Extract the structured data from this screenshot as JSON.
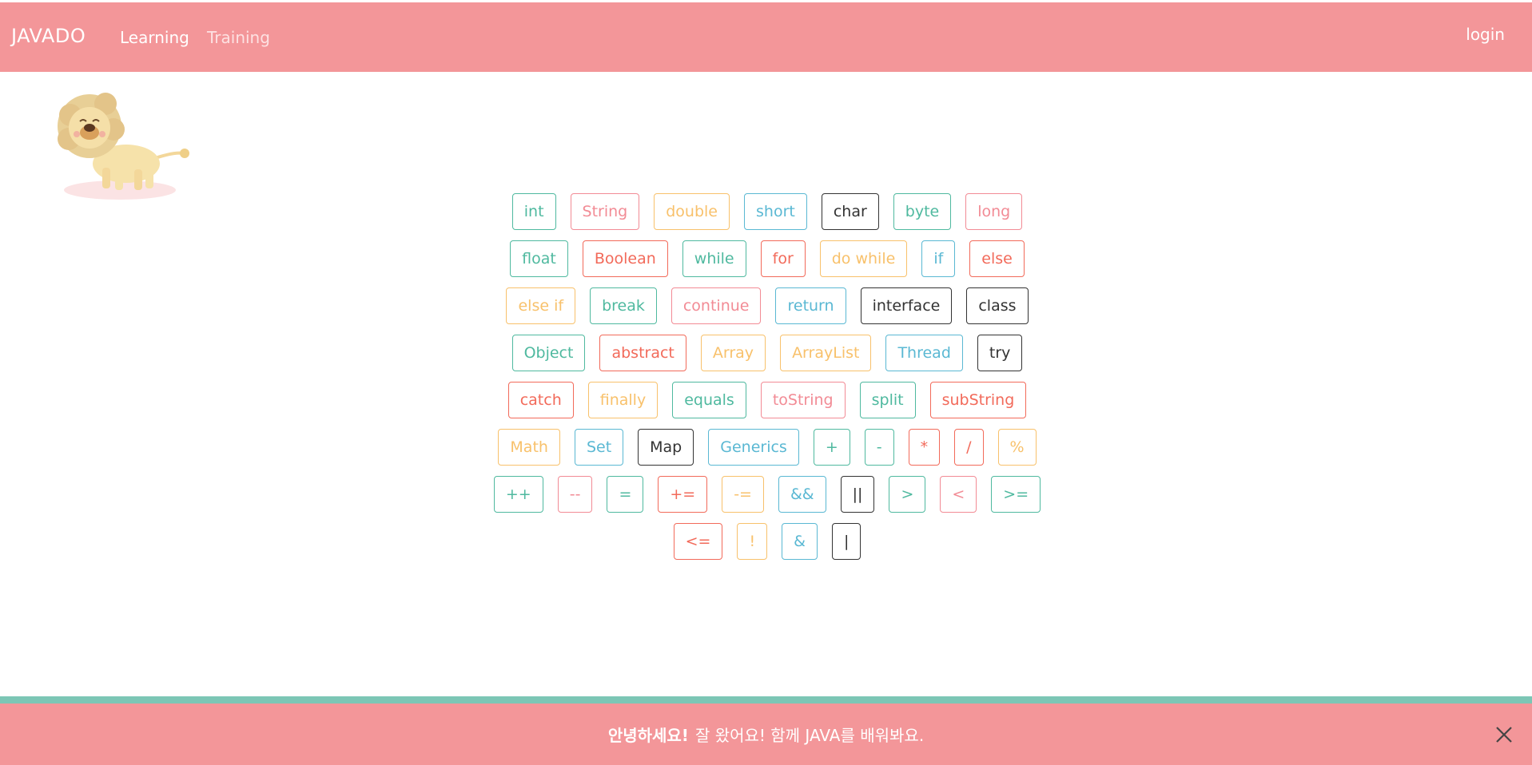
{
  "navbar": {
    "brand": "JAVADO",
    "links": [
      {
        "label": "Learning"
      },
      {
        "label": "Training"
      }
    ],
    "login_label": "login"
  },
  "keywords": [
    {
      "label": "int",
      "color": "teal"
    },
    {
      "label": "String",
      "color": "pink"
    },
    {
      "label": "double",
      "color": "yellow"
    },
    {
      "label": "short",
      "color": "blue"
    },
    {
      "label": "char",
      "color": "dark"
    },
    {
      "label": "byte",
      "color": "teal"
    },
    {
      "label": "long",
      "color": "pink"
    },
    {
      "label": "float",
      "color": "teal"
    },
    {
      "label": "Boolean",
      "color": "red"
    },
    {
      "label": "while",
      "color": "teal"
    },
    {
      "label": "for",
      "color": "red"
    },
    {
      "label": "do while",
      "color": "yellow"
    },
    {
      "label": "if",
      "color": "blue"
    },
    {
      "label": "else",
      "color": "red"
    },
    {
      "label": "else if",
      "color": "yellow"
    },
    {
      "label": "break",
      "color": "teal"
    },
    {
      "label": "continue",
      "color": "pink"
    },
    {
      "label": "return",
      "color": "blue"
    },
    {
      "label": "interface",
      "color": "dark"
    },
    {
      "label": "class",
      "color": "dark"
    },
    {
      "label": "Object",
      "color": "teal"
    },
    {
      "label": "abstract",
      "color": "red"
    },
    {
      "label": "Array",
      "color": "yellow"
    },
    {
      "label": "ArrayList",
      "color": "yellow"
    },
    {
      "label": "Thread",
      "color": "blue"
    },
    {
      "label": "try",
      "color": "dark"
    },
    {
      "label": "catch",
      "color": "red"
    },
    {
      "label": "finally",
      "color": "yellow"
    },
    {
      "label": "equals",
      "color": "teal"
    },
    {
      "label": "toString",
      "color": "pink"
    },
    {
      "label": "split",
      "color": "teal"
    },
    {
      "label": "subString",
      "color": "red"
    },
    {
      "label": "Math",
      "color": "yellow"
    },
    {
      "label": "Set",
      "color": "blue"
    },
    {
      "label": "Map",
      "color": "dark"
    },
    {
      "label": "Generics",
      "color": "blue"
    },
    {
      "label": "+",
      "color": "teal"
    },
    {
      "label": "-",
      "color": "teal"
    },
    {
      "label": "*",
      "color": "red"
    },
    {
      "label": "/",
      "color": "red"
    },
    {
      "label": "%",
      "color": "yellow"
    },
    {
      "label": "++",
      "color": "teal"
    },
    {
      "label": "--",
      "color": "pink"
    },
    {
      "label": "=",
      "color": "teal"
    },
    {
      "label": "+=",
      "color": "red"
    },
    {
      "label": "-=",
      "color": "yellow"
    },
    {
      "label": "&&",
      "color": "blue"
    },
    {
      "label": "||",
      "color": "dark"
    },
    {
      "label": ">",
      "color": "teal"
    },
    {
      "label": "<",
      "color": "pink"
    },
    {
      "label": ">=",
      "color": "teal"
    },
    {
      "label": "<=",
      "color": "red"
    },
    {
      "label": "!",
      "color": "yellow"
    },
    {
      "label": "&",
      "color": "blue"
    },
    {
      "label": "|",
      "color": "dark"
    }
  ],
  "banner": {
    "greeting": "안녕하세요!",
    "message": "잘 왔어요! 함께 JAVA를 배워봐요."
  },
  "colors": {
    "brand_pink": "#f39699",
    "footer_teal": "#7cc6b5"
  },
  "icons": {
    "mascot": "lion-mascot",
    "close": "close-icon"
  }
}
